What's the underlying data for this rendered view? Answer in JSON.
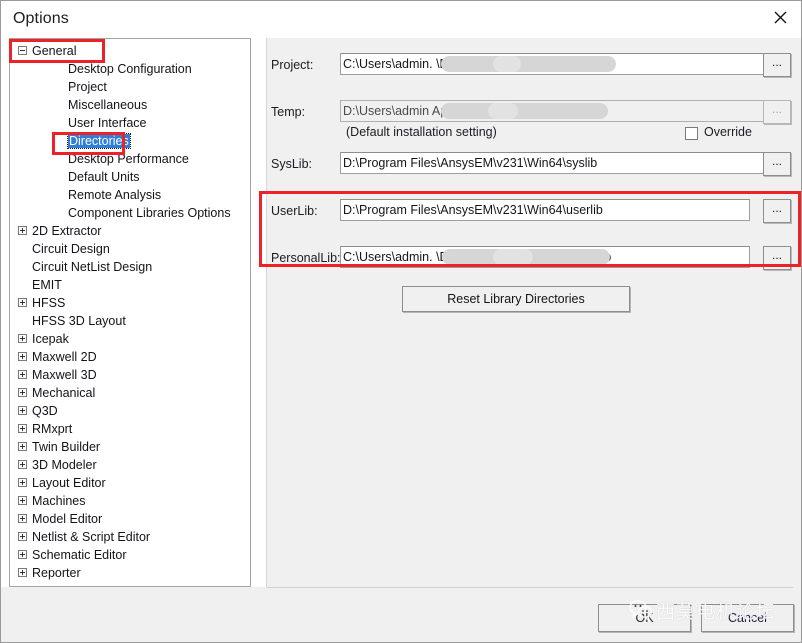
{
  "window": {
    "title": "Options",
    "close_icon": "close-icon"
  },
  "tree": {
    "items": [
      {
        "label": "General",
        "depth": 0,
        "expander": "minus",
        "selected": false
      },
      {
        "label": "Desktop Configuration",
        "depth": 1,
        "expander": "none",
        "selected": false
      },
      {
        "label": "Project",
        "depth": 1,
        "expander": "none",
        "selected": false
      },
      {
        "label": "Miscellaneous",
        "depth": 1,
        "expander": "none",
        "selected": false
      },
      {
        "label": "User Interface",
        "depth": 1,
        "expander": "none",
        "selected": false
      },
      {
        "label": "Directories",
        "depth": 1,
        "expander": "none",
        "selected": true
      },
      {
        "label": "Desktop Performance",
        "depth": 1,
        "expander": "none",
        "selected": false
      },
      {
        "label": "Default Units",
        "depth": 1,
        "expander": "none",
        "selected": false
      },
      {
        "label": "Remote Analysis",
        "depth": 1,
        "expander": "none",
        "selected": false
      },
      {
        "label": "Component Libraries Options",
        "depth": 1,
        "expander": "none",
        "selected": false
      },
      {
        "label": "2D Extractor",
        "depth": 0,
        "expander": "plus",
        "selected": false
      },
      {
        "label": "Circuit Design",
        "depth": 0,
        "expander": "none",
        "selected": false
      },
      {
        "label": "Circuit NetList Design",
        "depth": 0,
        "expander": "none",
        "selected": false
      },
      {
        "label": "EMIT",
        "depth": 0,
        "expander": "none",
        "selected": false
      },
      {
        "label": "HFSS",
        "depth": 0,
        "expander": "plus",
        "selected": false
      },
      {
        "label": "HFSS 3D Layout",
        "depth": 0,
        "expander": "none",
        "selected": false
      },
      {
        "label": "Icepak",
        "depth": 0,
        "expander": "plus",
        "selected": false
      },
      {
        "label": "Maxwell 2D",
        "depth": 0,
        "expander": "plus",
        "selected": false
      },
      {
        "label": "Maxwell 3D",
        "depth": 0,
        "expander": "plus",
        "selected": false
      },
      {
        "label": "Mechanical",
        "depth": 0,
        "expander": "plus",
        "selected": false
      },
      {
        "label": "Q3D",
        "depth": 0,
        "expander": "plus",
        "selected": false
      },
      {
        "label": "RMxprt",
        "depth": 0,
        "expander": "plus",
        "selected": false
      },
      {
        "label": "Twin Builder",
        "depth": 0,
        "expander": "plus",
        "selected": false
      },
      {
        "label": "3D Modeler",
        "depth": 0,
        "expander": "plus",
        "selected": false
      },
      {
        "label": "Layout Editor",
        "depth": 0,
        "expander": "plus",
        "selected": false
      },
      {
        "label": "Machines",
        "depth": 0,
        "expander": "plus",
        "selected": false
      },
      {
        "label": "Model Editor",
        "depth": 0,
        "expander": "plus",
        "selected": false
      },
      {
        "label": "Netlist & Script Editor",
        "depth": 0,
        "expander": "plus",
        "selected": false
      },
      {
        "label": "Schematic Editor",
        "depth": 0,
        "expander": "plus",
        "selected": false
      },
      {
        "label": "Reporter",
        "depth": 0,
        "expander": "plus",
        "selected": false
      }
    ]
  },
  "directories": {
    "project": {
      "label": "Project:",
      "value": "C:\\Users\\admin.                              \\Documents\\Ansoft",
      "browse_label": "...",
      "disabled": false
    },
    "temp": {
      "label": "Temp:",
      "value": "D:\\Users\\admin                              AppData\\Local\\Temp",
      "browse_label": "...",
      "disabled": true,
      "note": "(Default installation setting)",
      "override_label": "Override",
      "override_checked": false
    },
    "syslib": {
      "label": "SysLib:",
      "value": "D:\\Program Files\\AnsysEM\\v231\\Win64\\syslib",
      "browse_label": "...",
      "disabled": false
    },
    "userlib": {
      "label": "UserLib:",
      "value": "D:\\Program Files\\AnsysEM\\v231\\Win64\\userlib",
      "browse_label": "...",
      "disabled": false
    },
    "personallib": {
      "label": "PersonalLib:",
      "value": "C:\\Users\\admin.                             \\Documents\\Ansoft\\PersonalLib",
      "browse_label": "...",
      "disabled": false
    },
    "reset_button_label": "Reset Library Directories"
  },
  "footer": {
    "ok_label": "OK",
    "cancel_label": "Cancel"
  },
  "watermark": {
    "text": "西莫电机论坛",
    "icon": "wechat-icon"
  },
  "annotations": {
    "highlight_color": "#ec2227",
    "boxes": [
      {
        "name": "general-node-highlight"
      },
      {
        "name": "directories-node-highlight"
      },
      {
        "name": "library-paths-highlight"
      }
    ]
  }
}
